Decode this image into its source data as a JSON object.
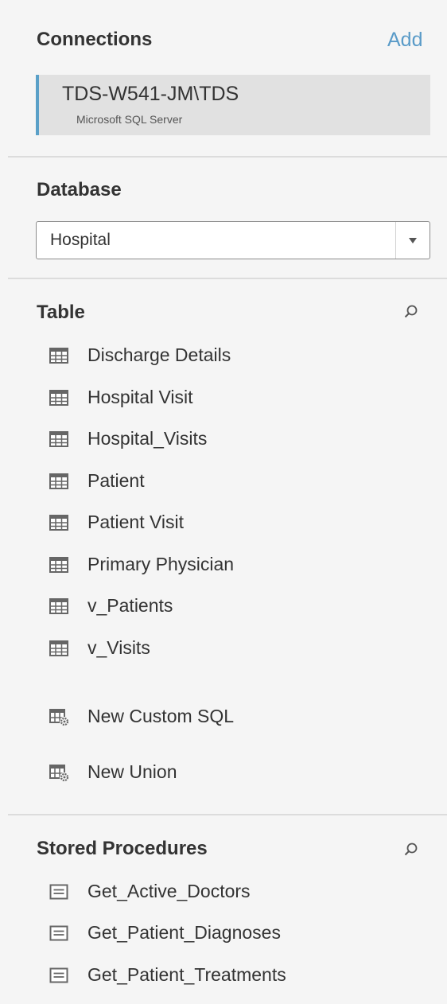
{
  "connections": {
    "title": "Connections",
    "add_label": "Add",
    "items": [
      {
        "name": "TDS-W541-JM\\TDS",
        "type": "Microsoft SQL Server"
      }
    ]
  },
  "database": {
    "title": "Database",
    "selected": "Hospital"
  },
  "table": {
    "title": "Table",
    "items": [
      {
        "label": "Discharge Details",
        "icon": "table-icon"
      },
      {
        "label": "Hospital Visit",
        "icon": "table-icon"
      },
      {
        "label": "Hospital_Visits",
        "icon": "table-icon"
      },
      {
        "label": "Patient",
        "icon": "table-icon"
      },
      {
        "label": "Patient Visit",
        "icon": "table-icon"
      },
      {
        "label": "Primary Physician",
        "icon": "table-icon"
      },
      {
        "label": "v_Patients",
        "icon": "table-icon"
      },
      {
        "label": "v_Visits",
        "icon": "table-icon"
      }
    ],
    "actions": [
      {
        "label": "New Custom SQL",
        "icon": "custom-table-gear-icon"
      },
      {
        "label": "New Union",
        "icon": "custom-table-gear-icon"
      }
    ]
  },
  "stored_procedures": {
    "title": "Stored Procedures",
    "items": [
      {
        "label": "Get_Active_Doctors",
        "icon": "procedure-icon"
      },
      {
        "label": "Get_Patient_Diagnoses",
        "icon": "procedure-icon"
      },
      {
        "label": "Get_Patient_Treatments",
        "icon": "procedure-icon"
      }
    ]
  },
  "colors": {
    "accent": "#5a9bc8",
    "icon": "#666666",
    "background": "#f5f5f5",
    "selected_row": "#e1e1e1"
  }
}
